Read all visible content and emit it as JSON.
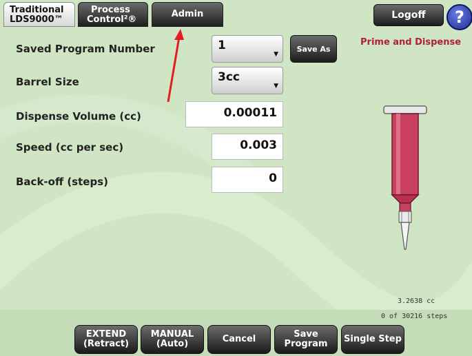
{
  "tabs": [
    {
      "line1": "Traditional",
      "line2": "LDS9000™"
    },
    {
      "line1": "Process",
      "line2": "Control²®"
    },
    {
      "line1": "Admin"
    }
  ],
  "header": {
    "logoff_label": "Logoff",
    "help_label": "?",
    "help_icon": "question-icon"
  },
  "form": {
    "saved_program_label": "Saved Program Number",
    "saved_program_value": "1",
    "save_as_label": "Save As",
    "barrel_size_label": "Barrel Size",
    "barrel_size_value": "3cc",
    "dispense_volume_label": "Dispense Volume (cc)",
    "dispense_volume_value": "0.00011",
    "speed_label": "Speed (cc per sec)",
    "speed_value": "0.003",
    "backoff_label": "Back-off (steps)",
    "backoff_value": "0"
  },
  "syringe_panel": {
    "title": "Prime and Dispense",
    "volume_readout": "3.2638 cc",
    "steps_readout": "0 of 30216 steps",
    "syringe_color": "#c9405e"
  },
  "bottom_buttons": [
    {
      "line1": "EXTEND",
      "line2": "(Retract)"
    },
    {
      "line1": "MANUAL",
      "line2": "(Auto)"
    },
    {
      "line1": "Cancel"
    },
    {
      "line1": "Save",
      "line2": "Program"
    },
    {
      "line1": "Single Step"
    }
  ],
  "colors": {
    "background": "#cfe5c4",
    "accent_red": "#b0203c",
    "annotation_arrow": "#e02020"
  }
}
